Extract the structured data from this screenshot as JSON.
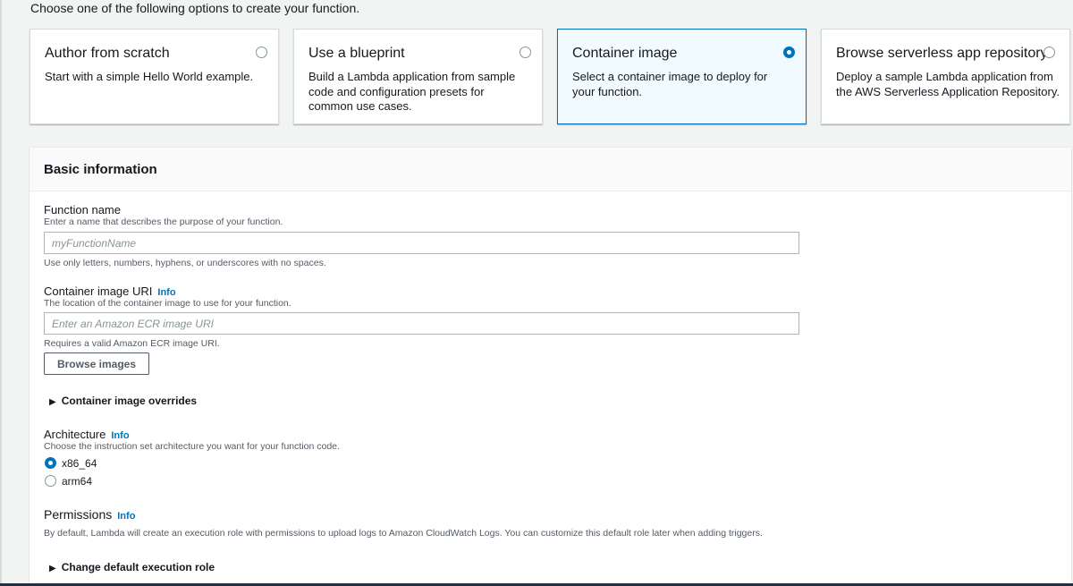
{
  "intro": "Choose one of the following options to create your function.",
  "options": [
    {
      "title": "Author from scratch",
      "description": "Start with a simple Hello World example.",
      "selected": false
    },
    {
      "title": "Use a blueprint",
      "description": "Build a Lambda application from sample code and configuration presets for common use cases.",
      "selected": false
    },
    {
      "title": "Container image",
      "description": "Select a container image to deploy for your function.",
      "selected": true
    },
    {
      "title": "Browse serverless app repository",
      "description": "Deploy a sample Lambda application from the AWS Serverless Application Repository.",
      "selected": false
    }
  ],
  "basic_info": {
    "title": "Basic information",
    "function_name": {
      "label": "Function name",
      "description": "Enter a name that describes the purpose of your function.",
      "placeholder": "myFunctionName",
      "value": "",
      "constraint": "Use only letters, numbers, hyphens, or underscores with no spaces."
    },
    "image_uri": {
      "label": "Container image URI",
      "info": "Info",
      "description": "The location of the container image to use for your function.",
      "placeholder": "Enter an Amazon ECR image URI",
      "value": "",
      "constraint": "Requires a valid Amazon ECR image URI."
    },
    "browse_button": "Browse images",
    "overrides_label": "Container image overrides",
    "architecture": {
      "label": "Architecture",
      "info": "Info",
      "description": "Choose the instruction set architecture you want for your function code.",
      "options": [
        {
          "label": "x86_64",
          "selected": true
        },
        {
          "label": "arm64",
          "selected": false
        }
      ]
    },
    "permissions": {
      "title": "Permissions",
      "info": "Info",
      "description": "By default, Lambda will create an execution role with permissions to upload logs to Amazon CloudWatch Logs. You can customize this default role later when adding triggers.",
      "expander": "Change default execution role"
    }
  },
  "colors": {
    "accent": "#0073bb",
    "selected_card_bg": "#f1faff",
    "border": "#d5dbdb"
  }
}
